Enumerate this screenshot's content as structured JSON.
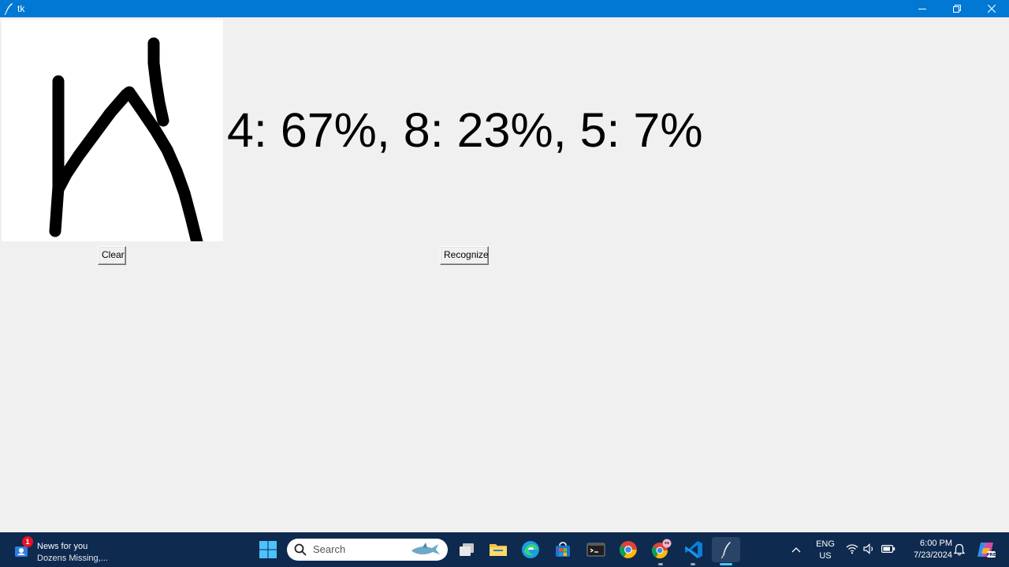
{
  "window": {
    "title": "tk",
    "controls": [
      "minimize",
      "maximize",
      "close"
    ]
  },
  "app": {
    "result_text": "4: 67%, 8: 23%, 5: 7%",
    "clear_label": "Clear",
    "recognize_label": "Recognize"
  },
  "taskbar": {
    "news": {
      "badge": "1",
      "title": "News for you",
      "subtitle": "Dozens Missing,..."
    },
    "search_placeholder": "Search",
    "pinned": [
      "windows-start",
      "search",
      "task-view",
      "file-explorer",
      "edge",
      "microsoft-store",
      "terminal",
      "chrome",
      "chrome-profile",
      "vscode",
      "tk-feather"
    ],
    "tray": {
      "language": "ENG",
      "region": "US",
      "time": "6:00 PM",
      "date": "7/23/2024"
    }
  },
  "colors": {
    "titlebar": "#0078d4",
    "background": "#f0f0f0",
    "canvas": "#ffffff",
    "taskbar": "#0e2a4f"
  }
}
